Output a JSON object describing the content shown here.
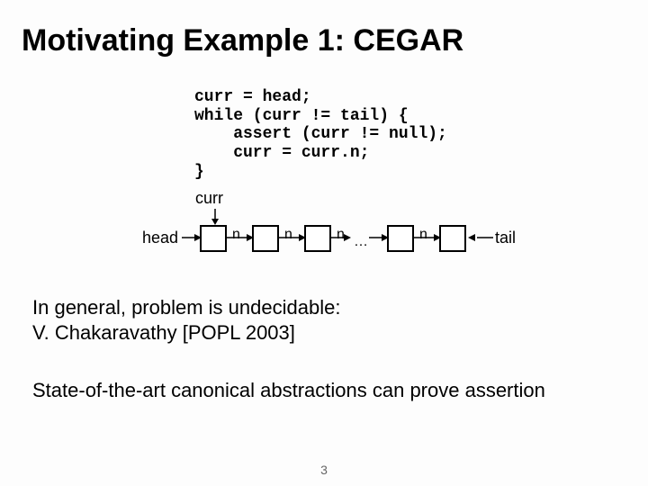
{
  "title": "Motivating Example 1: CEGAR",
  "code": "curr = head;\nwhile (curr != tail) {\n    assert (curr != null);\n    curr = curr.n;\n}",
  "diagram": {
    "curr": "curr",
    "head": "head",
    "tail": "tail",
    "n": "n",
    "dots": "…"
  },
  "paragraph1_line1": "In general, problem is undecidable:",
  "paragraph1_line2": "V. Chakaravathy [POPL 2003]",
  "paragraph2": "State-of-the-art canonical abstractions can prove assertion",
  "slide_number": "3"
}
